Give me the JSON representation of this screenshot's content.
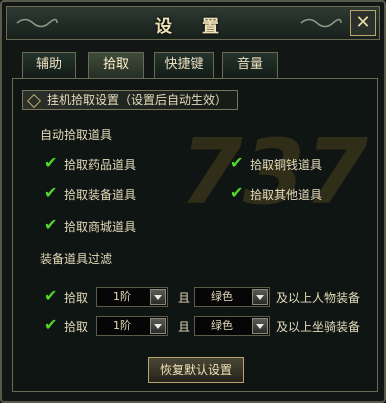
{
  "window": {
    "title": "设 置"
  },
  "tabs": [
    {
      "label": "辅助",
      "active": false
    },
    {
      "label": "拾取",
      "active": true
    },
    {
      "label": "快捷键",
      "active": false
    },
    {
      "label": "音量",
      "active": false
    }
  ],
  "panel": {
    "header": "挂机拾取设置（设置后自动生效）",
    "auto_section": "自动拾取道具",
    "items": [
      {
        "label": "拾取药品道具",
        "checked": true
      },
      {
        "label": "拾取铜钱道具",
        "checked": true
      },
      {
        "label": "拾取装备道具",
        "checked": true
      },
      {
        "label": "拾取其他道具",
        "checked": true
      },
      {
        "label": "拾取商城道具",
        "checked": true
      }
    ],
    "filter_section": "装备道具过滤",
    "filters": [
      {
        "prefix": "拾取",
        "level": "1阶",
        "conj": "且",
        "color": "绿色",
        "suffix": "及以上人物装备",
        "checked": true
      },
      {
        "prefix": "拾取",
        "level": "1阶",
        "conj": "且",
        "color": "绿色",
        "suffix": "及以上坐骑装备",
        "checked": true
      }
    ],
    "reset_button": "恢复默认设置"
  },
  "watermark": "737",
  "colors": {
    "check": "#4fd82b",
    "text": "#e6dcbc",
    "border": "#6b6a52"
  }
}
